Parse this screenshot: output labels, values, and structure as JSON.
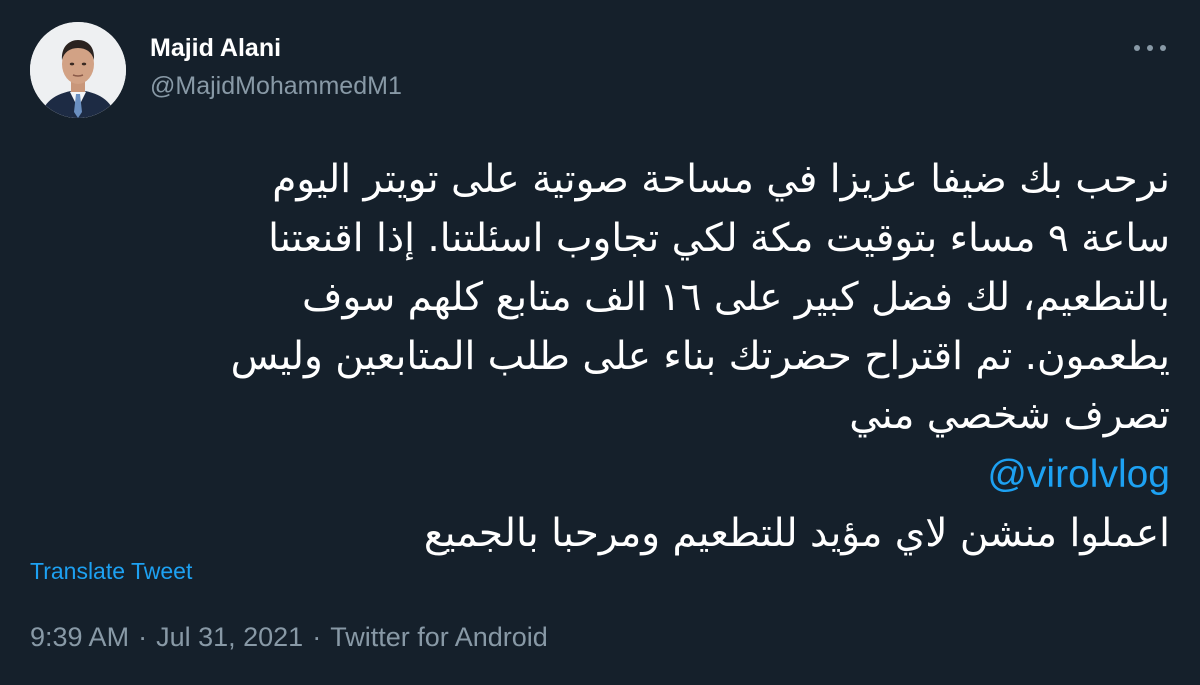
{
  "author": {
    "display_name": "Majid Alani",
    "handle": "@MajidMohammedM1",
    "avatar_icon": "profile-photo"
  },
  "more_icon": "more-horizontal-icon",
  "tweet": {
    "lines": [
      "نرحب بك ضيفا عزيزا في مساحة صوتية على تويتر اليوم",
      "ساعة ٩ مساء بتوقيت مكة لكي تجاوب اسئلتنا. إذا اقنعتنا",
      "بالتطعيم، لك فضل كبير على ١٦ الف متابع كلهم سوف",
      "يطعمون. تم اقتراح حضرتك بناء على طلب المتابعين وليس",
      "تصرف شخصي مني"
    ],
    "mention": "@virolvlog",
    "last_line": "اعملوا منشن لاي مؤيد للتطعيم ومرحبا بالجميع"
  },
  "translate_label": "Translate Tweet",
  "meta": {
    "time": "9:39 AM",
    "separator": "·",
    "date": "Jul 31, 2021",
    "source": "Twitter for Android"
  },
  "colors": {
    "background": "#15202b",
    "text": "#ffffff",
    "secondary": "#8899a6",
    "link": "#1da1f2"
  }
}
